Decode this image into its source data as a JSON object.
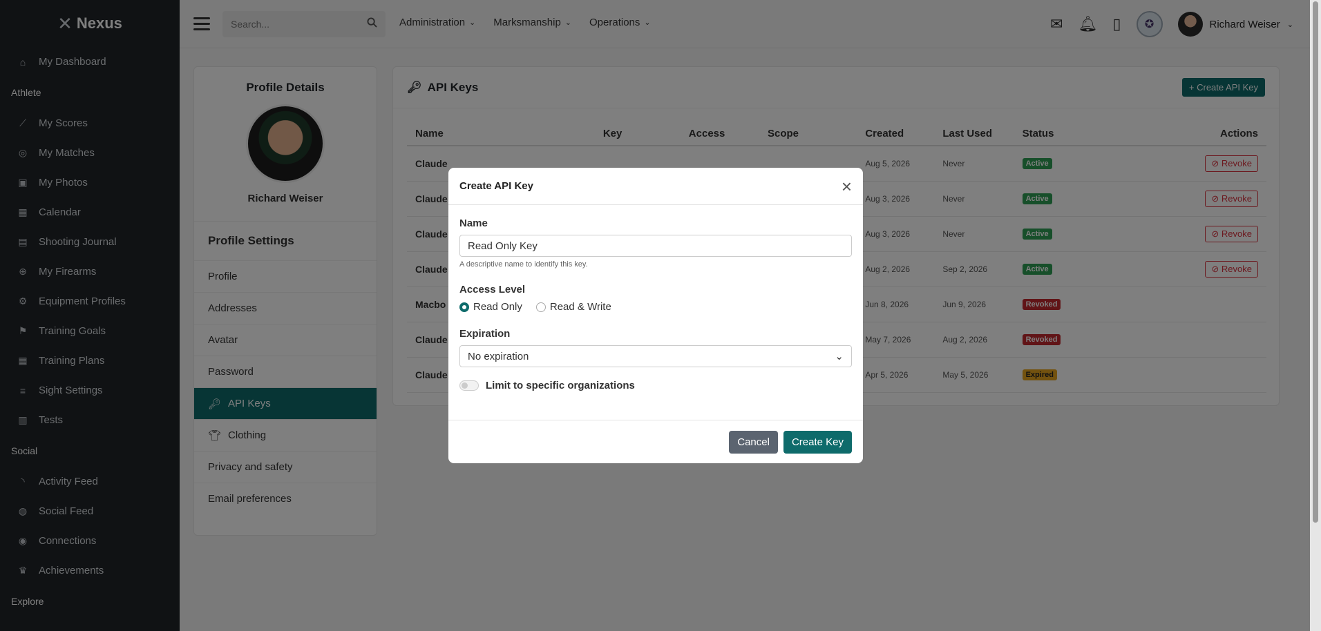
{
  "brand": {
    "name": "Nexus"
  },
  "sidebar": {
    "items_top": [
      {
        "label": "My Dashboard",
        "icon": "home-icon",
        "glyph": "⌂"
      }
    ],
    "section_athlete": "Athlete",
    "athlete_items": [
      {
        "label": "My Scores",
        "icon": "chart-line-icon",
        "glyph": "⟋"
      },
      {
        "label": "My Matches",
        "icon": "target-icon",
        "glyph": "◎"
      },
      {
        "label": "My Photos",
        "icon": "camera-icon",
        "glyph": "▣"
      },
      {
        "label": "Calendar",
        "icon": "calendar-icon",
        "glyph": "▦"
      },
      {
        "label": "Shooting Journal",
        "icon": "book-icon",
        "glyph": "▤"
      },
      {
        "label": "My Firearms",
        "icon": "crosshair-icon",
        "glyph": "⊕"
      },
      {
        "label": "Equipment Profiles",
        "icon": "gear-icon",
        "glyph": "⚙"
      },
      {
        "label": "Training Goals",
        "icon": "flag-icon",
        "glyph": "⚑"
      },
      {
        "label": "Training Plans",
        "icon": "calendar-check-icon",
        "glyph": "▦"
      },
      {
        "label": "Sight Settings",
        "icon": "sliders-icon",
        "glyph": "≡"
      },
      {
        "label": "Tests",
        "icon": "clipboard-icon",
        "glyph": "▥"
      }
    ],
    "section_social": "Social",
    "social_items": [
      {
        "label": "Activity Feed",
        "icon": "rss-icon",
        "glyph": "◝"
      },
      {
        "label": "Social Feed",
        "icon": "comments-icon",
        "glyph": "◍"
      },
      {
        "label": "Connections",
        "icon": "users-icon",
        "glyph": "◉"
      },
      {
        "label": "Achievements",
        "icon": "trophy-icon",
        "glyph": "♛"
      }
    ],
    "section_explore": "Explore"
  },
  "topbar": {
    "search_placeholder": "Search...",
    "menus": [
      "Administration",
      "Marksmanship",
      "Operations"
    ],
    "user_name": "Richard Weiser"
  },
  "profile": {
    "details_title": "Profile Details",
    "name": "Richard Weiser",
    "settings_title": "Profile Settings",
    "settings_items": [
      {
        "label": "Profile",
        "active": false
      },
      {
        "label": "Addresses",
        "active": false
      },
      {
        "label": "Avatar",
        "active": false
      },
      {
        "label": "Password",
        "active": false
      },
      {
        "label": "API Keys",
        "active": true,
        "icon": "key-icon"
      },
      {
        "label": "Clothing",
        "active": false,
        "icon": "shirt-icon"
      },
      {
        "label": "Privacy and safety",
        "active": false
      },
      {
        "label": "Email preferences",
        "active": false
      }
    ]
  },
  "api_keys": {
    "title": "API Keys",
    "create_button": "+ Create API Key",
    "columns": [
      "Name",
      "Key",
      "Access",
      "Scope",
      "Created",
      "Last Used",
      "Status",
      "Actions"
    ],
    "rows": [
      {
        "name": "Claude",
        "created": "Aug 5, 2026",
        "last_used": "Never",
        "status": "Active",
        "status_kind": "green",
        "action": "Revoke"
      },
      {
        "name": "Claude",
        "created": "Aug 3, 2026",
        "last_used": "Never",
        "status": "Active",
        "status_kind": "green",
        "action": "Revoke"
      },
      {
        "name": "Claude",
        "created": "Aug 3, 2026",
        "last_used": "Never",
        "status": "Active",
        "status_kind": "green",
        "action": "Revoke"
      },
      {
        "name": "Claude",
        "created": "Aug 2, 2026",
        "last_used": "Sep 2, 2026",
        "status": "Active",
        "status_kind": "green",
        "action": "Revoke"
      },
      {
        "name": "Macbo",
        "created": "Jun 8, 2026",
        "last_used": "Jun 9, 2026",
        "status": "Revoked",
        "status_kind": "red",
        "action": ""
      },
      {
        "name": "Claude",
        "created": "May 7, 2026",
        "last_used": "Aug 2, 2026",
        "status": "Revoked",
        "status_kind": "red",
        "action": ""
      },
      {
        "name": "Claude",
        "created": "Apr 5, 2026",
        "last_used": "May 5, 2026",
        "status": "Expired",
        "status_kind": "yellow",
        "action": ""
      }
    ]
  },
  "modal": {
    "title": "Create API Key",
    "name_label": "Name",
    "name_value": "Read Only Key",
    "name_hint": "A descriptive name to identify this key.",
    "access_label": "Access Level",
    "access_options": [
      "Read Only",
      "Read & Write"
    ],
    "access_selected": "Read Only",
    "expiration_label": "Expiration",
    "expiration_value": "No expiration",
    "limit_label": "Limit to specific organizations",
    "limit_enabled": false,
    "cancel_label": "Cancel",
    "create_label": "Create Key"
  },
  "colors": {
    "sidebar_bg": "#212529",
    "accent": "#0e6b6b",
    "danger": "#d9333f"
  }
}
